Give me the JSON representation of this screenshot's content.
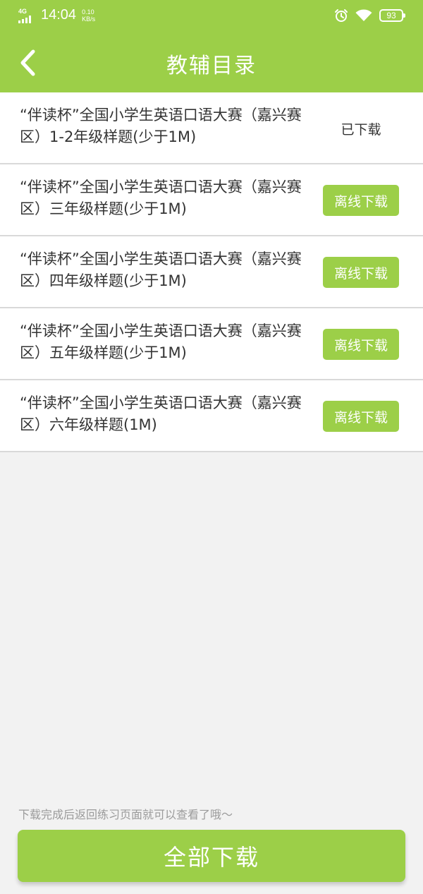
{
  "status_bar": {
    "network": "4G",
    "time": "14:04",
    "speed_value": "0.10",
    "speed_unit": "KB/s",
    "battery": "93",
    "icons": [
      "signal-icon",
      "alarm-icon",
      "wifi-icon",
      "battery-icon"
    ]
  },
  "header": {
    "title": "教辅目录",
    "back_icon": "chevron-left-icon"
  },
  "items": [
    {
      "title": "“伴读杯”全国小学生英语口语大赛（嘉兴赛区）1-2年级样题(少于1M)",
      "action": "已下载",
      "state": "downloaded"
    },
    {
      "title": "“伴读杯”全国小学生英语口语大赛（嘉兴赛区）三年级样题(少于1M)",
      "action": "离线下载",
      "state": "available"
    },
    {
      "title": "“伴读杯”全国小学生英语口语大赛（嘉兴赛区）四年级样题(少于1M)",
      "action": "离线下载",
      "state": "available"
    },
    {
      "title": "“伴读杯”全国小学生英语口语大赛（嘉兴赛区）五年级样题(少于1M)",
      "action": "离线下载",
      "state": "available"
    },
    {
      "title": "“伴读杯”全国小学生英语口语大赛（嘉兴赛区）六年级样题(1M)",
      "action": "离线下载",
      "state": "available"
    }
  ],
  "footer": {
    "hint": "下载完成后返回练习页面就可以查看了哦～",
    "download_all": "全部下载"
  },
  "colors": {
    "accent": "#9ccf48",
    "background": "#f2f2f2",
    "text": "#333333",
    "hint": "#9b9b9b"
  }
}
